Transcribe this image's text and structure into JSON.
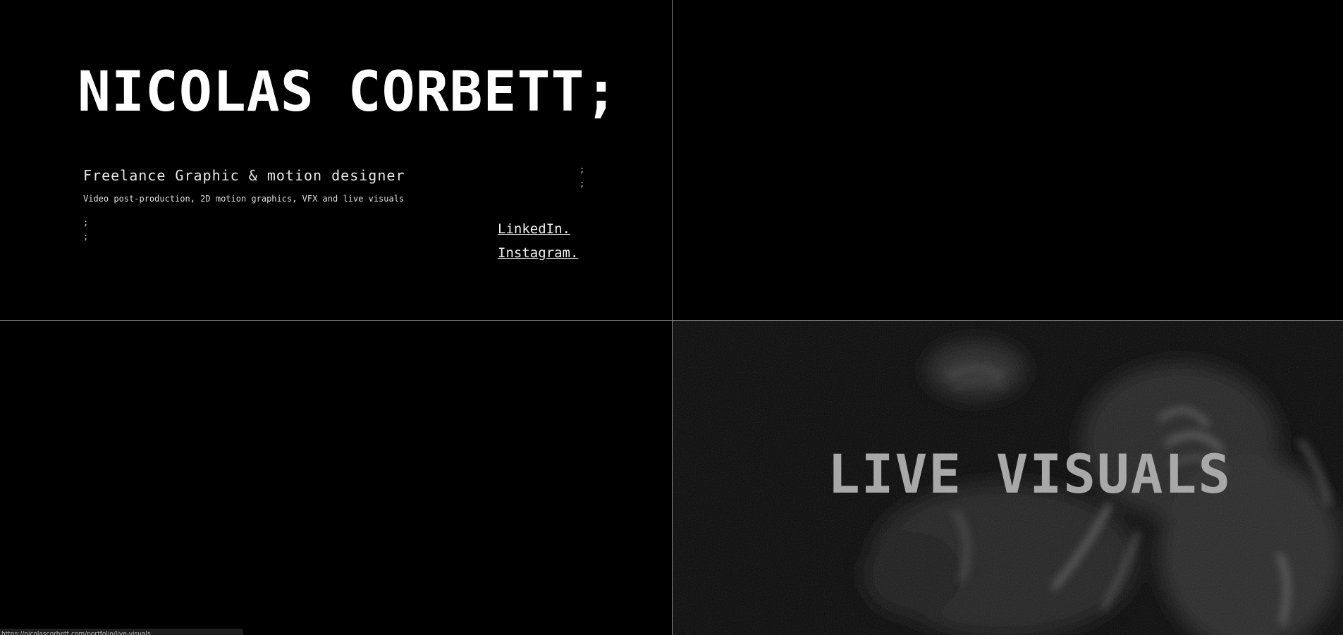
{
  "header": {
    "name": "NICOLAS CORBETT;",
    "role": "Freelance Graphic & motion designer",
    "services": "Video post-production, 2D motion graphics, VFX and live visuals",
    "semis_left": ";\n;",
    "semis_right": ";\n;"
  },
  "links": [
    {
      "label": "LinkedIn."
    },
    {
      "label": "Instagram."
    }
  ],
  "projects": [
    {
      "label": "LIVE VISUALS"
    }
  ],
  "status_bar": {
    "url_text": "https://nicolascorbett.com/portfolio/live-visuals"
  }
}
